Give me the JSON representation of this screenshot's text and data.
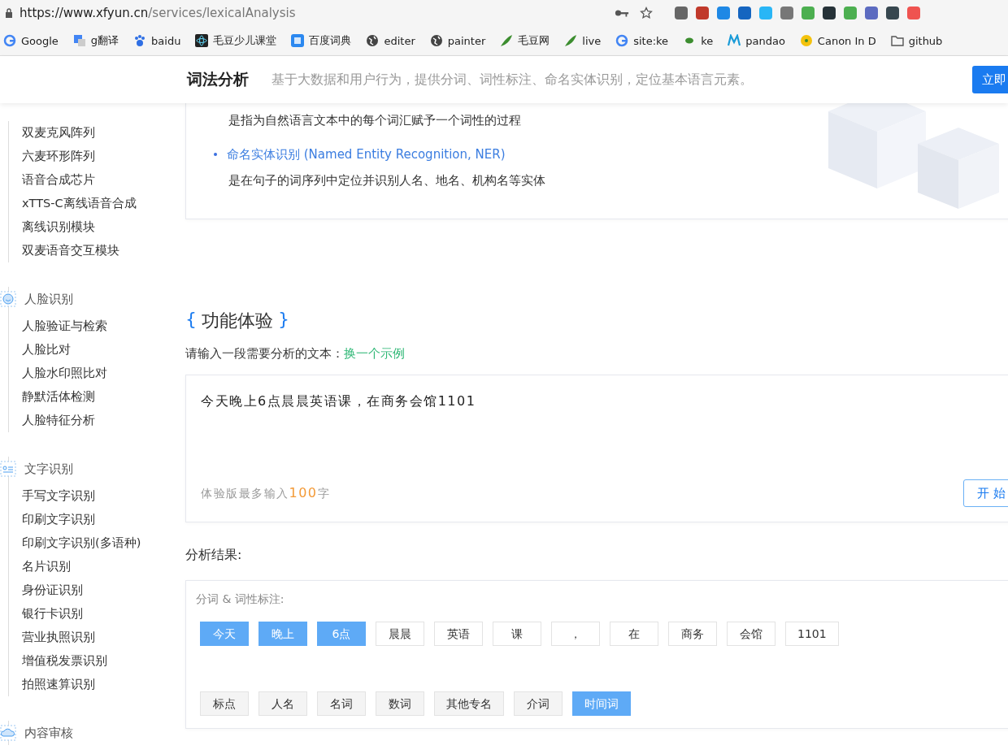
{
  "browser": {
    "url_host": "https://www.xfyun.cn",
    "url_path": "/services/lexicalAnalysis",
    "bookmarks": [
      "Google",
      "g翻译",
      "baidu",
      "毛豆少儿课堂",
      "百度词典",
      "editer",
      "painter",
      "毛豆网",
      "live",
      "site:ke",
      "ke",
      "pandao",
      "Canon In D",
      "github"
    ]
  },
  "header": {
    "title": "词法分析",
    "subtitle": "基于大数据和用户行为，提供分词、词性标注、命名实体识别，定位基本语言元素。",
    "button": "立即"
  },
  "sidebar": [
    {
      "items": [
        "双麦克风阵列",
        "六麦环形阵列",
        "语音合成芯片",
        "xTTS-C离线语音合成",
        "离线识别模块",
        "双麦语音交互模块"
      ]
    },
    {
      "title": "人脸识别",
      "items": [
        "人脸验证与检索",
        "人脸比对",
        "人脸水印照比对",
        "静默活体检测",
        "人脸特征分析"
      ]
    },
    {
      "title": "文字识别",
      "items": [
        "手写文字识别",
        "印刷文字识别",
        "印刷文字识别(多语种)",
        "名片识别",
        "身份证识别",
        "银行卡识别",
        "营业执照识别",
        "增值税发票识别",
        "拍照速算识别"
      ]
    },
    {
      "title": "内容审核"
    }
  ],
  "intro": {
    "lead_desc": "是指为自然语言文本中的每个词汇赋予一个词性的过程",
    "features": [
      {
        "name": "命名实体识别 (Named Entity Recognition, NER)",
        "desc": "是在句子的词序列中定位并识别人名、地名、机构名等实体"
      }
    ]
  },
  "demo": {
    "brace_open": "{",
    "title": "功能体验",
    "brace_close": "}",
    "prompt": "请输入一段需要分析的文本：",
    "example_link": "换一个示例",
    "input_value": "今天晚上6点晨晨英语课，在商务会馆1101",
    "limit_before": "体验版最多输入",
    "limit_number": "100",
    "limit_after": "字",
    "start_button": "开 始"
  },
  "results": {
    "heading": "分析结果:",
    "section_label": "分词 & 词性标注:",
    "tokens": [
      {
        "text": "今天",
        "selected": true
      },
      {
        "text": "晚上",
        "selected": true
      },
      {
        "text": "6点",
        "selected": true
      },
      {
        "text": "晨晨",
        "selected": false
      },
      {
        "text": "英语",
        "selected": false
      },
      {
        "text": "课",
        "selected": false
      },
      {
        "text": "，",
        "selected": false
      },
      {
        "text": "在",
        "selected": false
      },
      {
        "text": "商务",
        "selected": false
      },
      {
        "text": "会馆",
        "selected": false
      },
      {
        "text": "1101",
        "selected": false
      }
    ],
    "legend": [
      {
        "text": "标点",
        "selected": false
      },
      {
        "text": "人名",
        "selected": false
      },
      {
        "text": "名词",
        "selected": false
      },
      {
        "text": "数词",
        "selected": false
      },
      {
        "text": "其他专名",
        "selected": false
      },
      {
        "text": "介词",
        "selected": false
      },
      {
        "text": "时间词",
        "selected": true
      }
    ]
  }
}
